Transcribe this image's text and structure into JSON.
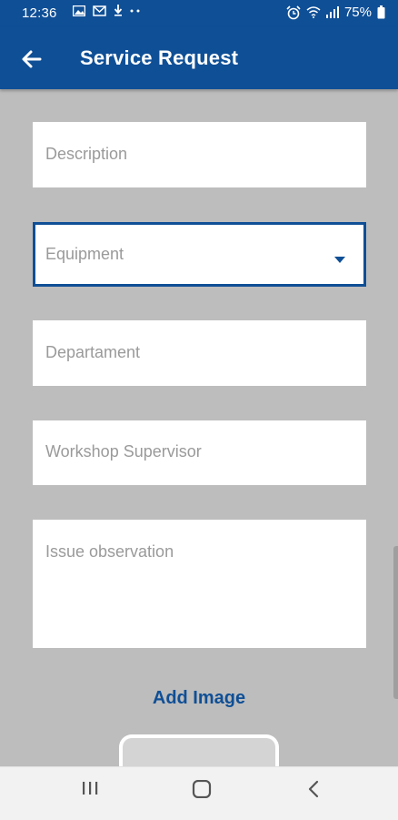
{
  "status_bar": {
    "time": "12:36",
    "battery": "75%",
    "notification_icons": [
      "gallery-icon",
      "gmail-icon",
      "download-icon",
      "more-dots-icon"
    ],
    "system_icons": [
      "alarm-icon",
      "wifi-icon",
      "signal-icon",
      "battery-icon"
    ]
  },
  "app_bar": {
    "title": "Service Request",
    "back_icon": "arrow-left-icon",
    "background": "#0f4f96"
  },
  "form": {
    "description": {
      "placeholder": "Description",
      "value": ""
    },
    "equipment": {
      "placeholder": "Equipment",
      "selected": "",
      "focused": true
    },
    "department": {
      "placeholder": "Departament",
      "value": ""
    },
    "workshop_supervisor": {
      "placeholder": "Workshop Supervisor",
      "value": ""
    },
    "issue_observation": {
      "placeholder": "Issue observation",
      "value": ""
    }
  },
  "add_image_label": "Add Image",
  "nav_bar": {
    "recent_icon": "recent-apps-icon",
    "home_icon": "home-icon",
    "back_icon": "back-chevron-icon"
  },
  "colors": {
    "primary": "#0f4f96",
    "page_background": "#bdbdbd",
    "field_background": "#ffffff",
    "placeholder_text": "#9a9a9a"
  }
}
